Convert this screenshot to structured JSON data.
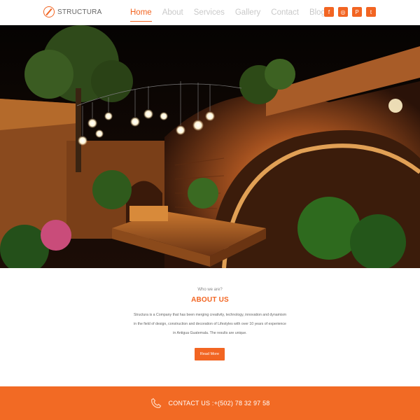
{
  "brand": {
    "name": "STRUCTURA",
    "accent": "#f26522"
  },
  "nav": {
    "items": [
      {
        "label": "Home",
        "active": true
      },
      {
        "label": "About",
        "active": false
      },
      {
        "label": "Services",
        "active": false
      },
      {
        "label": "Gallery",
        "active": false
      },
      {
        "label": "Contact",
        "active": false
      },
      {
        "label": "Blog",
        "active": false
      }
    ]
  },
  "social": [
    {
      "icon": "facebook-icon",
      "glyph": "f"
    },
    {
      "icon": "instagram-icon",
      "glyph": "◎"
    },
    {
      "icon": "pinterest-icon",
      "glyph": "P"
    },
    {
      "icon": "tripadvisor-icon",
      "glyph": "t"
    }
  ],
  "about": {
    "kicker": "Who we are?",
    "title": "ABOUT US",
    "body": "Structura is a Company that has been merging creativity, technology, innovation and dynamism in the field of design, construction and decoration of Lifestyles with over 10 years of experience in Antigua Guatemala. The results are unique.",
    "button_label": "Read More"
  },
  "contact": {
    "label": "CONTACT US :+(502) 78 32 97 58",
    "icon": "phone-icon"
  }
}
